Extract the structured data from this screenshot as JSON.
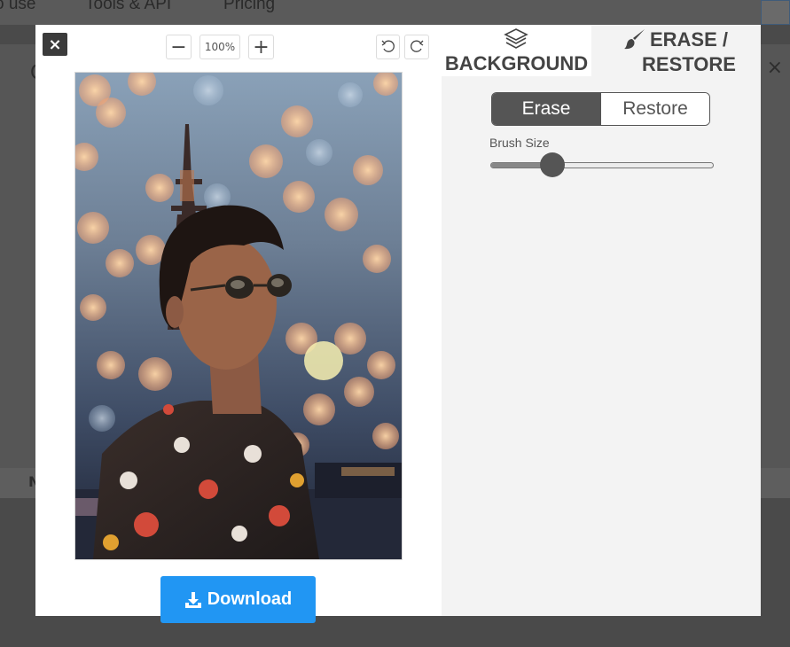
{
  "background_page": {
    "nav": [
      "o use",
      "Tools & API",
      "Pricing"
    ],
    "card_letter": "C",
    "card_close": "×",
    "card_footer_text": "N"
  },
  "modal": {
    "close_icon": "×",
    "zoom": {
      "minus": "−",
      "value": "100%",
      "plus": "+"
    },
    "download_label": "Download"
  },
  "panel": {
    "tabs": [
      {
        "label": "BACKGROUND",
        "icon": "layers-icon",
        "active": false
      },
      {
        "label": "ERASE / RESTORE",
        "icon": "paintbrush-icon",
        "active": true
      }
    ],
    "mode": {
      "erase": "Erase",
      "restore": "Restore",
      "selected": "Erase"
    },
    "brush": {
      "label": "Brush Size",
      "value_fraction": 0.28
    }
  },
  "colors": {
    "download": "#2196f3",
    "segment_active": "#555555",
    "panel_bg": "#f3f3f3"
  }
}
